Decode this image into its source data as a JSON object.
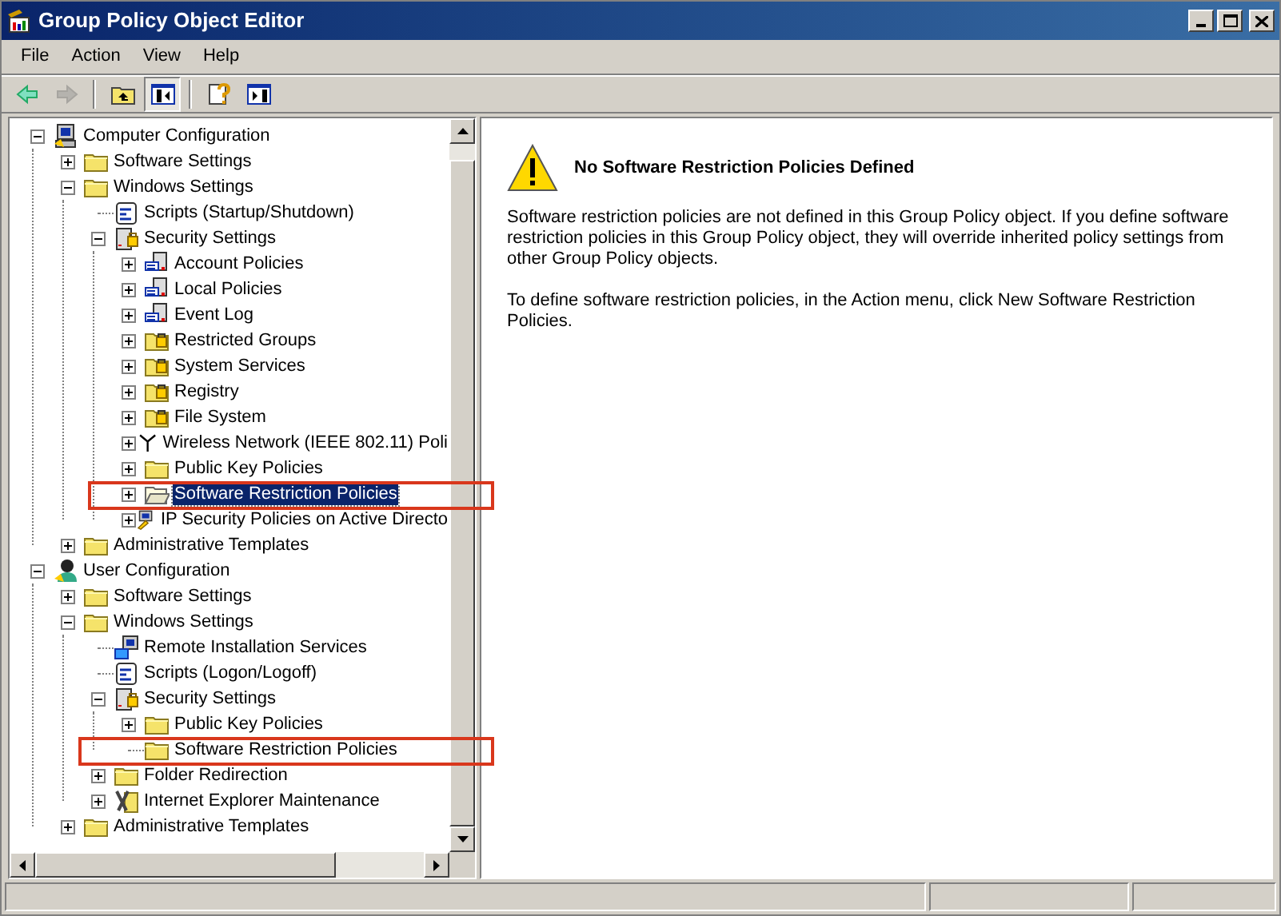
{
  "window": {
    "title": "Group Policy Object Editor"
  },
  "menu": [
    {
      "label": "File"
    },
    {
      "label": "Action"
    },
    {
      "label": "View"
    },
    {
      "label": "Help"
    }
  ],
  "toolbar": [
    {
      "kind": "back",
      "disabled": false
    },
    {
      "kind": "forward",
      "disabled": true
    },
    {
      "kind": "separator"
    },
    {
      "kind": "up",
      "pressed": false
    },
    {
      "kind": "tree-toggle",
      "pressed": true
    },
    {
      "kind": "separator"
    },
    {
      "kind": "help"
    },
    {
      "kind": "action-pane"
    }
  ],
  "tree": [
    {
      "label": "Computer Configuration",
      "kind": "computer",
      "expanded": true,
      "selected": false,
      "children": [
        {
          "label": "Software Settings",
          "kind": "folder",
          "expanded": false,
          "selected": false
        },
        {
          "label": "Windows Settings",
          "kind": "folder",
          "expanded": true,
          "selected": false,
          "children": [
            {
              "label": "Scripts (Startup/Shutdown)",
              "kind": "scripts",
              "selected": false
            },
            {
              "label": "Security Settings",
              "kind": "security",
              "expanded": true,
              "selected": false,
              "children": [
                {
                  "label": "Account Policies",
                  "kind": "server",
                  "expanded": false,
                  "selected": false
                },
                {
                  "label": "Local Policies",
                  "kind": "server",
                  "expanded": false,
                  "selected": false
                },
                {
                  "label": "Event Log",
                  "kind": "server",
                  "expanded": false,
                  "selected": false
                },
                {
                  "label": "Restricted Groups",
                  "kind": "lock-folder",
                  "expanded": false,
                  "selected": false
                },
                {
                  "label": "System Services",
                  "kind": "lock-folder",
                  "expanded": false,
                  "selected": false
                },
                {
                  "label": "Registry",
                  "kind": "lock-folder",
                  "expanded": false,
                  "selected": false
                },
                {
                  "label": "File System",
                  "kind": "lock-folder",
                  "expanded": false,
                  "selected": false
                },
                {
                  "label": "Wireless Network (IEEE 802.11) Poli",
                  "kind": "antenna",
                  "expanded": false,
                  "selected": false
                },
                {
                  "label": "Public Key Policies",
                  "kind": "folder",
                  "expanded": false,
                  "selected": false
                },
                {
                  "label": "Software Restriction Policies",
                  "kind": "open-folder",
                  "expanded": false,
                  "selected": true
                },
                {
                  "label": "IP Security Policies on Active Directo",
                  "kind": "ip-security",
                  "expanded": false,
                  "selected": false
                }
              ]
            }
          ]
        },
        {
          "label": "Administrative Templates",
          "kind": "folder",
          "expanded": false,
          "selected": false
        }
      ]
    },
    {
      "label": "User Configuration",
      "kind": "user",
      "expanded": true,
      "selected": false,
      "children": [
        {
          "label": "Software Settings",
          "kind": "folder",
          "expanded": false,
          "selected": false
        },
        {
          "label": "Windows Settings",
          "kind": "folder",
          "expanded": true,
          "selected": false,
          "children": [
            {
              "label": "Remote Installation Services",
              "kind": "remote",
              "selected": false
            },
            {
              "label": "Scripts (Logon/Logoff)",
              "kind": "scripts",
              "selected": false
            },
            {
              "label": "Security Settings",
              "kind": "security",
              "expanded": true,
              "selected": false,
              "children": [
                {
                  "label": "Public Key Policies",
                  "kind": "folder",
                  "expanded": false,
                  "selected": false
                },
                {
                  "label": "Software Restriction Policies",
                  "kind": "folder",
                  "selected": false
                }
              ]
            },
            {
              "label": "Folder Redirection",
              "kind": "folder",
              "expanded": false,
              "selected": false
            },
            {
              "label": "Internet Explorer Maintenance",
              "kind": "ie",
              "expanded": false,
              "selected": false
            }
          ]
        },
        {
          "label": "Administrative Templates",
          "kind": "folder",
          "expanded": false,
          "selected": false
        }
      ]
    }
  ],
  "details": {
    "title": "No Software Restriction Policies Defined",
    "paragraphs": [
      "Software restriction policies are not defined in this Group Policy object. If you define software restriction policies in this Group Policy object, they will override inherited policy settings from other Group Policy objects.",
      "To define software restriction policies, in the Action menu, click New Software Restriction Policies."
    ]
  }
}
